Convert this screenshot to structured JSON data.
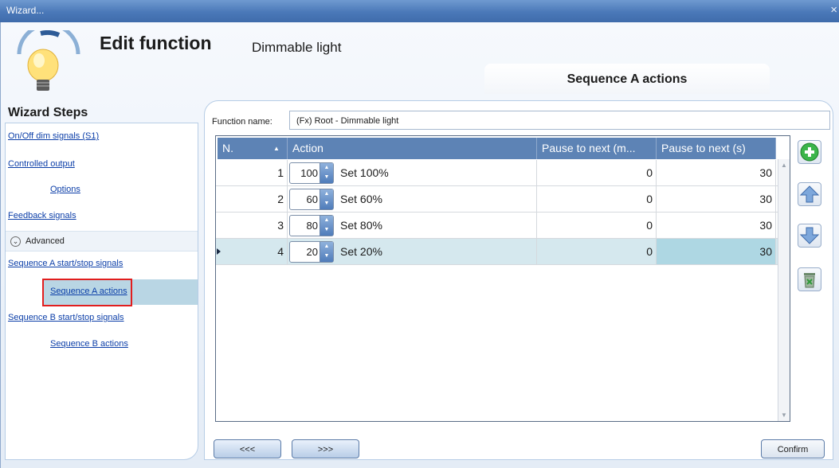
{
  "window": {
    "title": "Wizard...",
    "close_glyph": "×"
  },
  "header": {
    "title": "Edit function",
    "subtitle": "Dimmable light",
    "icon": "lightbulb-icon"
  },
  "tab": {
    "label": "Sequence A actions"
  },
  "wizard": {
    "title": "Wizard Steps",
    "steps": [
      "On/Off dim signals (S1)",
      "Controlled output",
      "Options",
      "Feedback signals",
      "Advanced",
      "Sequence A start/stop signals",
      "Sequence A actions",
      "Sequence B start/stop signals",
      "Sequence B actions"
    ],
    "selected_index": 6
  },
  "form": {
    "function_label": "Function name:",
    "function_value": "(Fx) Root - Dimmable light"
  },
  "grid": {
    "columns": [
      "N.",
      "Action",
      "Pause to next (m...",
      "Pause to next (s)"
    ],
    "sort_glyph": "▲",
    "rows": [
      {
        "n": "1",
        "level": "100",
        "label": "Set 100%",
        "pause_m": "0",
        "pause_s": "30"
      },
      {
        "n": "2",
        "level": "60",
        "label": "Set 60%",
        "pause_m": "0",
        "pause_s": "30"
      },
      {
        "n": "3",
        "level": "80",
        "label": "Set 80%",
        "pause_m": "0",
        "pause_s": "30"
      },
      {
        "n": "4",
        "level": "20",
        "label": "Set 20%",
        "pause_m": "0",
        "pause_s": "30"
      }
    ],
    "selected_row": 4
  },
  "side_buttons": [
    "add-icon",
    "move-up-icon",
    "move-down-icon",
    "delete-icon"
  ],
  "footer": {
    "prev": "<<<",
    "next": ">>>",
    "confirm": "Confirm"
  },
  "colors": {
    "header_bar": "#5d83b5",
    "selection": "#b9d6e4",
    "highlight_box": "#e11e1e"
  }
}
